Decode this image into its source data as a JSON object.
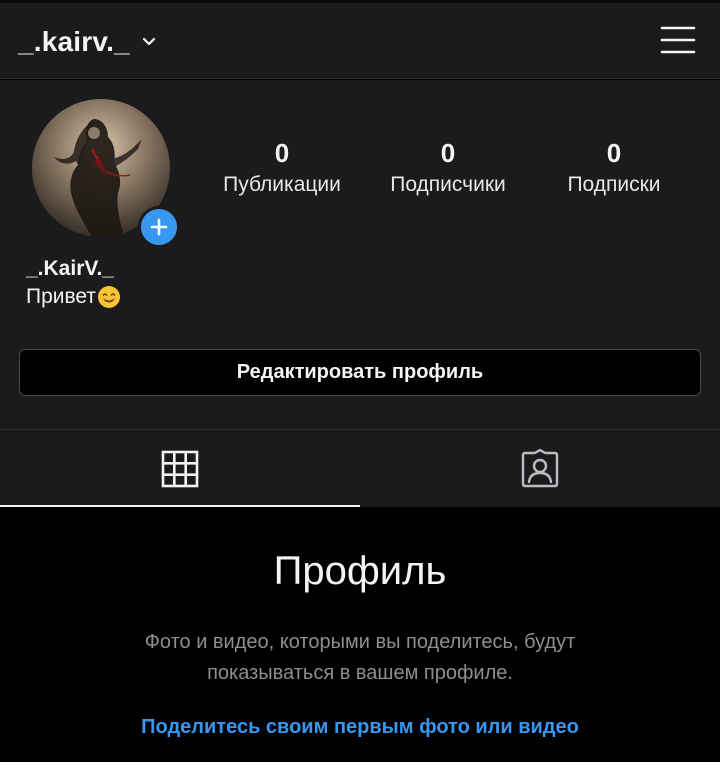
{
  "header": {
    "username": "_.kairv._"
  },
  "profile": {
    "display_name": "_.KairV._",
    "bio": "Привет",
    "bio_emoji": "smiling-face-emoji",
    "stats": [
      {
        "value": "0",
        "label": "Публикации"
      },
      {
        "value": "0",
        "label": "Подписчики"
      },
      {
        "value": "0",
        "label": "Подписки"
      }
    ],
    "edit_button_label": "Редактировать профиль"
  },
  "tabs": [
    {
      "icon": "grid-icon",
      "active": true
    },
    {
      "icon": "tagged-photos-icon",
      "active": false
    }
  ],
  "empty_state": {
    "title": "Профиль",
    "description": "Фото и видео, которыми вы поделитесь, будут показываться в вашем профиле.",
    "cta": "Поделитесь своим первым фото или видео"
  },
  "colors": {
    "background": "#000000",
    "surface": "#1b1a1d",
    "accent": "#3897f0",
    "muted_text": "#8e8e92"
  }
}
